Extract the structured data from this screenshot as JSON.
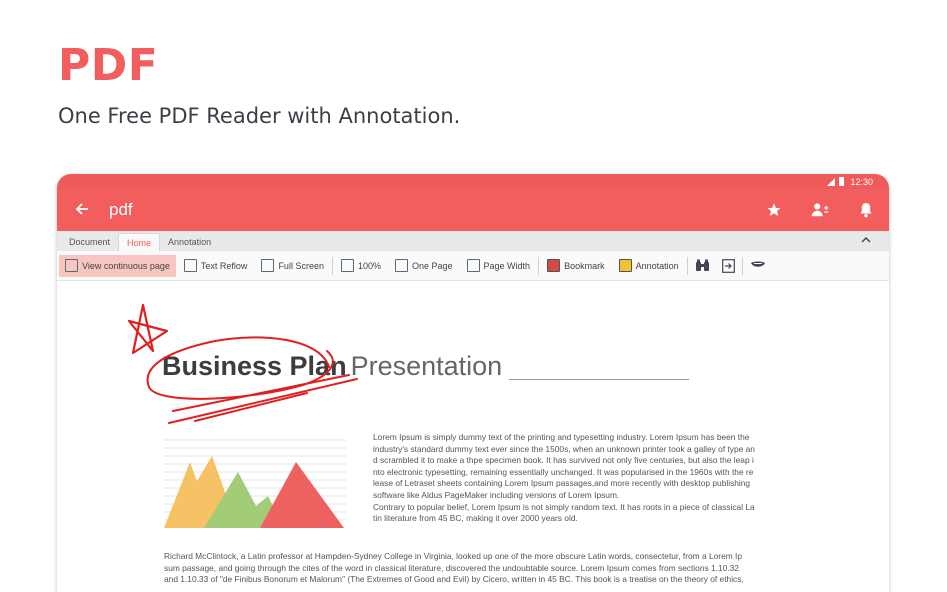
{
  "promo": {
    "title": "PDF",
    "subtitle": "One Free PDF Reader with Annotation."
  },
  "status_bar": {
    "time": "12:30"
  },
  "app_bar": {
    "title": "pdf",
    "icons": [
      "back-arrow-icon",
      "star-icon",
      "person-add-icon",
      "bell-icon"
    ]
  },
  "tabs": [
    {
      "label": "Document",
      "active": false
    },
    {
      "label": "Home",
      "active": true
    },
    {
      "label": "Annotation",
      "active": false
    }
  ],
  "toolbar": {
    "view_continuous": "View continuous page",
    "text_reflow": "Text Reflow",
    "full_screen": "Full Screen",
    "zoom": "100%",
    "one_page": "One Page",
    "page_width": "Page Width",
    "bookmark": "Bookmark",
    "annotation": "Annotation"
  },
  "document": {
    "title_bold": "Business Plan",
    "title_light": "Presentation",
    "para1_lines": [
      "Lorem Ipsum is simply dummy text of the printing and typesetting industry. Lorem Ipsum has been the",
      "industry's standard dummy text ever since the 1500s, when an unknown printer took a galley of type an",
      "d scrambled it to make a thpe specimen book. It has survived not only five centuries, but also the leap i",
      "nto electronic typesetting, remaining essentially unchanged. It was popularised in the 1960s with the re",
      "lease of Letraset sheets containing Lorem Ipsum passages,and more recently with desktop publishing",
      "software like Aldus PageMaker including versions of Lorem Ipsum.",
      "Contrary to popular belief, Lorem Ipsum is not simply random text. It has roots in a piece of classical La",
      "tin literature from 45 BC, making it over 2000 years old."
    ],
    "para2_lines": [
      "Richard McClintock, a Latin professor at Hampden-Sydney College in Virginia, looked up one of the more obscure Latin words, consectetur, from a Lorem Ip",
      "sum passage, and going through the cites of the word in classical literature, discovered the undoubtable source. Lorem Ipsum comes from sections 1.10.32",
      "and 1.10.33 of \"de Finibus Bonorum et Malorum\" (The Extremes of Good and Evil) by Cicero, written in 45 BC. This book is a treatise on the theory of ethics,"
    ]
  },
  "colors": {
    "accent": "#f25d5d",
    "status_bar": "#ef5a5a",
    "ink": "#e02020",
    "mountain_yellow": "#f5c266",
    "mountain_green": "#a3cc77",
    "mountain_red": "#ed6161"
  }
}
